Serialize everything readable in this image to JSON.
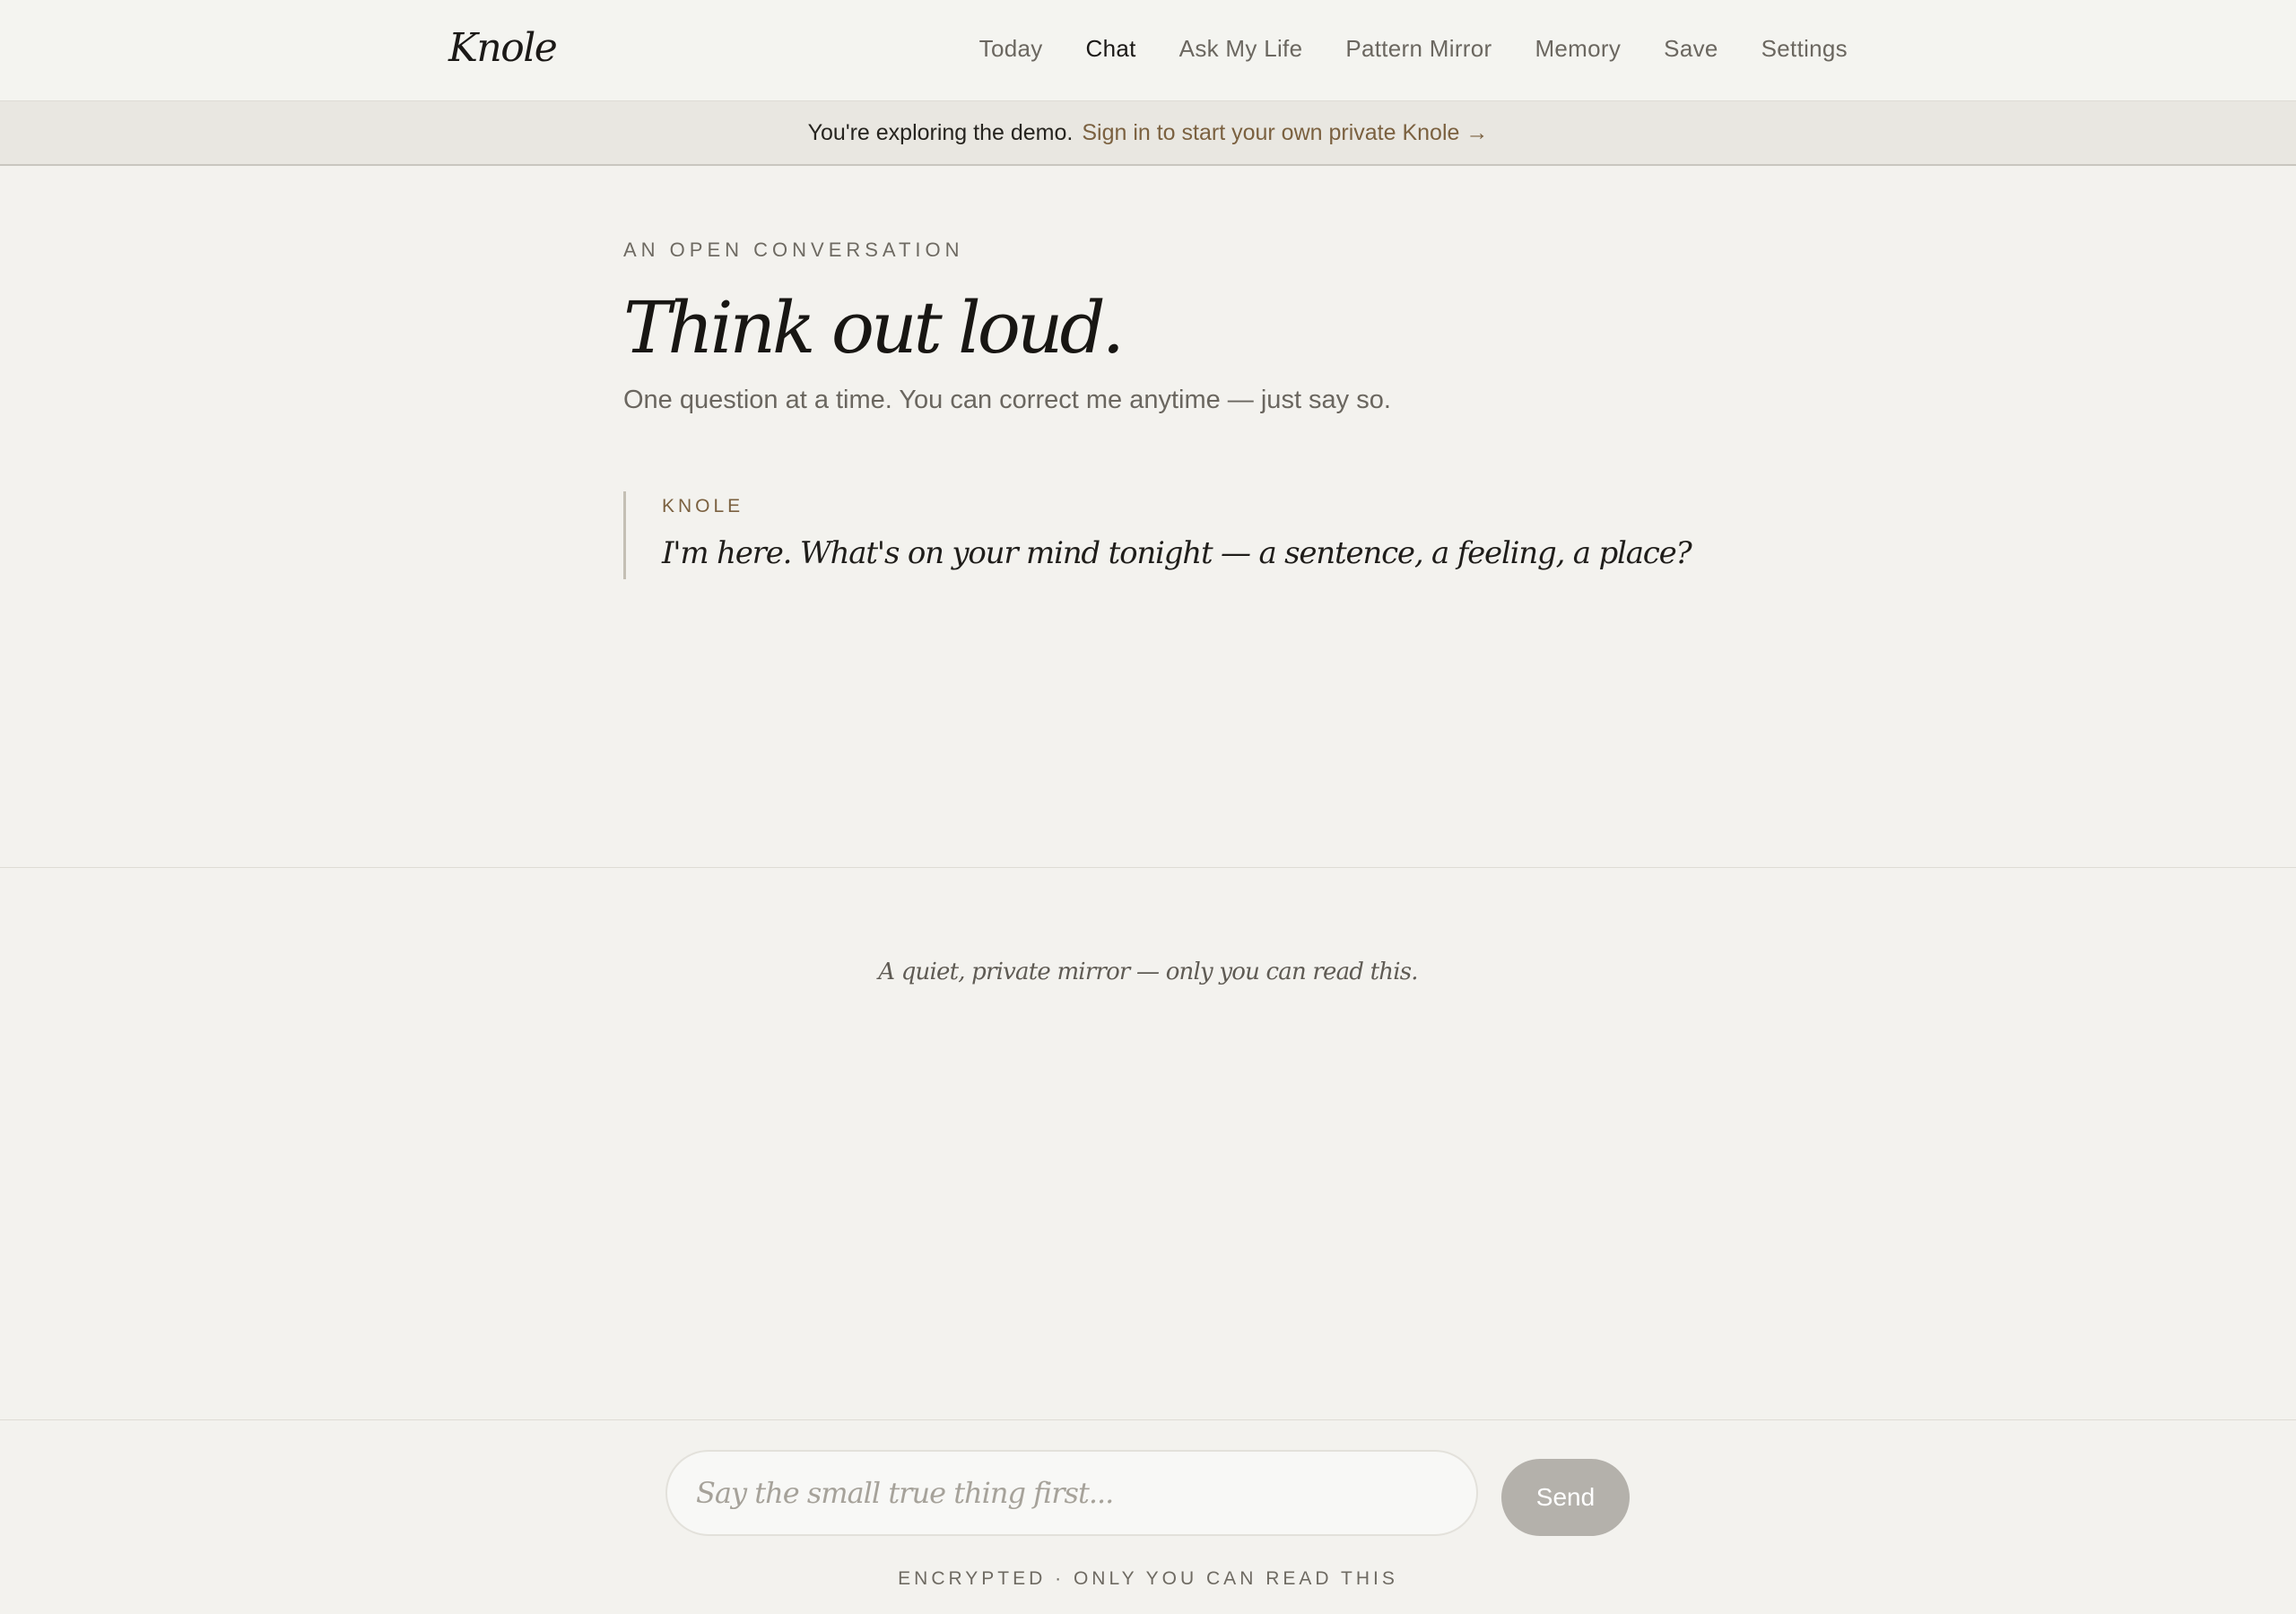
{
  "header": {
    "logo": "Knole",
    "nav": [
      {
        "label": "Today",
        "active": false
      },
      {
        "label": "Chat",
        "active": true
      },
      {
        "label": "Ask My Life",
        "active": false
      },
      {
        "label": "Pattern Mirror",
        "active": false
      },
      {
        "label": "Memory",
        "active": false
      },
      {
        "label": "Save",
        "active": false
      },
      {
        "label": "Settings",
        "active": false
      }
    ]
  },
  "banner": {
    "text": "You're exploring the demo.",
    "link": "Sign in to start your own private Knole →"
  },
  "main": {
    "eyebrow": "AN OPEN CONVERSATION",
    "title": "Think out loud.",
    "subtitle": "One question at a time. You can correct me anytime — just say so."
  },
  "conversation": {
    "messages": [
      {
        "author": "KNOLE",
        "text": "I'm here. What's on your mind tonight — a sentence, a feeling, a place?"
      }
    ]
  },
  "quiet_note": "A quiet, private mirror — only you can read this.",
  "composer": {
    "placeholder": "Say the small true thing first...",
    "value": "",
    "send_label": "Send"
  },
  "footer": {
    "note": "ENCRYPTED · ONLY YOU CAN READ THIS"
  },
  "colors": {
    "background": "#f3f2ee",
    "accent": "#7b6140",
    "text": "#1b1917",
    "muted": "#6b6760",
    "send_button": "#b4b1ab"
  }
}
